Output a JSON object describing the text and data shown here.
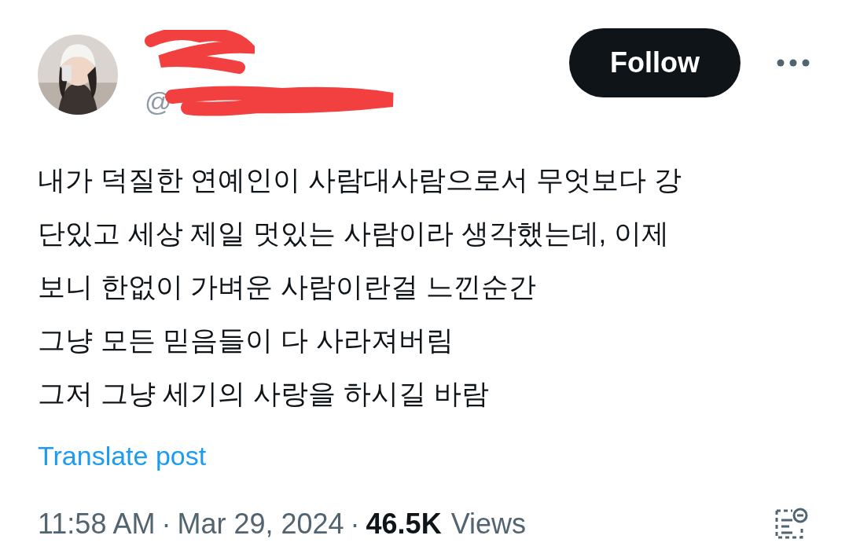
{
  "author": {
    "handle_prefix": "@"
  },
  "follow_button": "Follow",
  "body_lines": [
    "내가 덕질한 연예인이 사람대사람으로서 무엇보다 강",
    "단있고 세상 제일 멋있는 사람이라 생각했는데, 이제",
    "보니 한없이 가벼운 사람이란걸 느낀순간",
    "그냥 모든 믿음들이 다 사라져버림",
    "그저 그냥 세기의 사랑을 하시길 바람"
  ],
  "translate_link": "Translate post",
  "meta": {
    "time": "11:58 AM",
    "separator": "·",
    "date": "Mar 29, 2024",
    "views_count": "46.5K",
    "views_label": "Views"
  }
}
